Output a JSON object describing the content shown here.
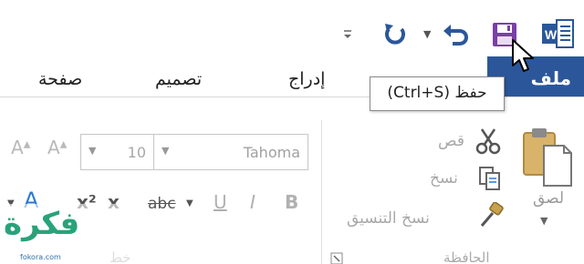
{
  "quick_access": {
    "customize_icon": "customize-qat-icon"
  },
  "ribbon": {
    "tabs": {
      "file": "ملف",
      "insert": "إدراج",
      "design": "تصميم",
      "page": "صفحة"
    },
    "accent": "#2b579a"
  },
  "tooltip": {
    "text": "حفظ (Ctrl+S)"
  },
  "clipboard": {
    "paste_label": "لصق",
    "cut_label": "قص",
    "copy_label": "نسخ",
    "format_painter_label": "نسخ التنسيق",
    "group_label": "الحافظة"
  },
  "font": {
    "font_name": "Tahoma",
    "font_size": "10",
    "grow_label": "A",
    "shrink_label": "A",
    "bold": "B",
    "italic": "I",
    "underline": "U",
    "strikethrough": "abc",
    "subscript": "x",
    "superscript": "x²",
    "effects": "A",
    "group_label": "خط"
  },
  "watermark": {
    "logo_text": "فكرة",
    "site": "fokora.com"
  }
}
